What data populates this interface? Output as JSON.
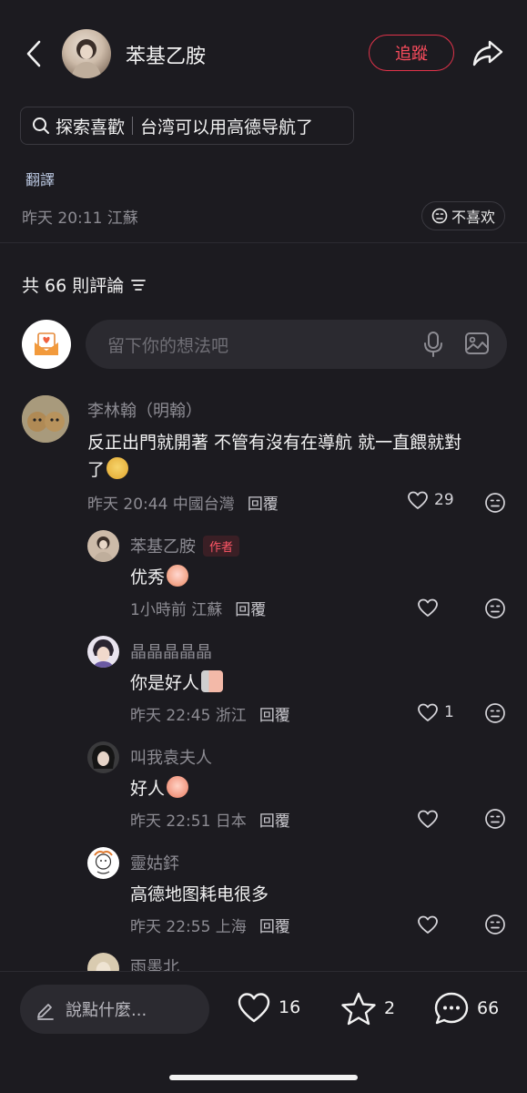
{
  "header": {
    "author_name": "苯基乙胺",
    "follow_label": "追蹤"
  },
  "search_chip": {
    "label": "探索喜歡",
    "query": "台湾可以用高德导航了"
  },
  "post": {
    "translate_label": "翻譯",
    "meta": "昨天 20:11 江蘇",
    "dislike_label": "不喜欢"
  },
  "comments_section": {
    "title": "共 66 則評論",
    "input_placeholder": "留下你的想法吧"
  },
  "comments": [
    {
      "name": "李林翰（明翰）",
      "text_line1": "反正出門就開著 不管有沒有在導航 就一直餵就對",
      "text_line2": "了",
      "meta": "昨天 20:44 中國台灣",
      "reply_label": "回覆",
      "likes": "29"
    }
  ],
  "replies": [
    {
      "name": "苯基乙胺",
      "badge": "作者",
      "text": "优秀",
      "meta": "1小時前 江蘇",
      "reply_label": "回覆",
      "likes": ""
    },
    {
      "name": "晶晶晶晶晶",
      "text": "你是好人",
      "meta": "昨天 22:45 浙江",
      "reply_label": "回覆",
      "likes": "1"
    },
    {
      "name": "叫我袁夫人",
      "text": "好人",
      "meta": "昨天 22:51 日本",
      "reply_label": "回覆",
      "likes": ""
    },
    {
      "name": "靈姑銔",
      "text": "高德地图耗电很多",
      "meta": "昨天 22:55 上海",
      "reply_label": "回覆",
      "likes": ""
    },
    {
      "name": "雨墨北"
    }
  ],
  "bottom_bar": {
    "say_placeholder": "說點什麼...",
    "likes": "16",
    "stars": "2",
    "comments": "66"
  },
  "colors": {
    "background": "#1c1b20",
    "accent": "#e0334a",
    "muted_text": "#8d8c93"
  },
  "icons": [
    "back-icon",
    "share-icon",
    "search-icon",
    "dislike-face-icon",
    "sort-icon",
    "mic-icon",
    "image-icon",
    "heart-icon",
    "neutral-face-icon",
    "pencil-icon",
    "star-icon",
    "comment-bubble-icon"
  ]
}
